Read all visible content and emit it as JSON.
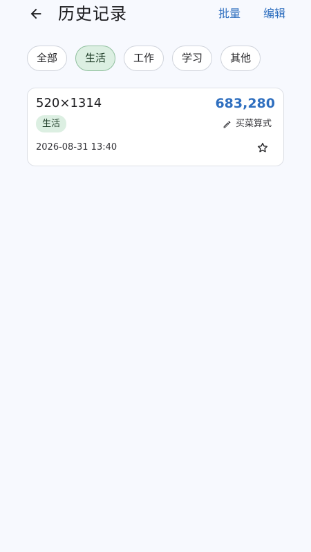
{
  "header": {
    "title": "历史记录",
    "back_icon": "arrow-left-icon",
    "actions": {
      "batch": "批量",
      "edit": "编辑"
    }
  },
  "filters": {
    "chips": [
      {
        "label": "全部",
        "active": false
      },
      {
        "label": "生活",
        "active": true
      },
      {
        "label": "工作",
        "active": false
      },
      {
        "label": "学习",
        "active": false
      },
      {
        "label": "其他",
        "active": false
      }
    ]
  },
  "history": {
    "items": [
      {
        "expression": "520×1314",
        "result": "683,280",
        "tag": "生活",
        "note": "买菜算式",
        "note_icon": "pencil-icon",
        "timestamp": "2026-08-31  13:40",
        "starred": false,
        "star_icon": "star-outline-icon"
      }
    ]
  },
  "colors": {
    "accent": "#2f6fbf",
    "background": "#f7f9fe",
    "chip_active_bg": "#dcefe2",
    "chip_active_border": "#8fbf9d",
    "card_border": "#dde0e6"
  }
}
